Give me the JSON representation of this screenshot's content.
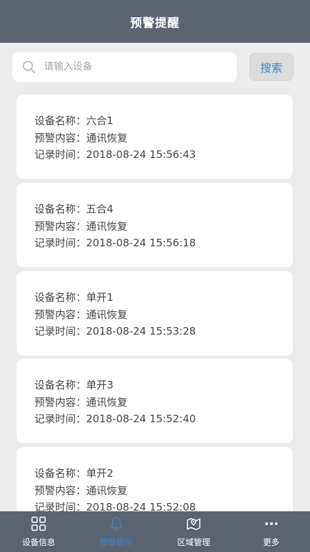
{
  "header": {
    "title": "预警提醒"
  },
  "search": {
    "placeholder": "请输入设备",
    "button_label": "搜索"
  },
  "records": [
    {
      "name": "设备名称：六合1",
      "content": "预警内容：通讯恢复",
      "time": "记录时间：2018-08-24 15:56:43"
    },
    {
      "name": "设备名称：五合4",
      "content": "预警内容：通讯恢复",
      "time": "记录时间：2018-08-24 15:56:18"
    },
    {
      "name": "设备名称：单开1",
      "content": "预警内容：通讯恢复",
      "time": "记录时间：2018-08-24 15:53:28"
    },
    {
      "name": "设备名称：单开3",
      "content": "预警内容：通讯恢复",
      "time": "记录时间：2018-08-24 15:52:40"
    },
    {
      "name": "设备名称：单开2",
      "content": "预警内容：通讯恢复",
      "time": "记录时间：2018-08-24 15:52:08"
    }
  ],
  "tabbar": {
    "items": [
      {
        "label": "设备信息",
        "icon": "grid-icon",
        "active": false
      },
      {
        "label": "预警提示",
        "icon": "bell-icon",
        "active": true
      },
      {
        "label": "区域管理",
        "icon": "map-icon",
        "active": false
      },
      {
        "label": "更多",
        "icon": "more-icon",
        "active": false
      }
    ]
  },
  "colors": {
    "header_bg": "#5b6370",
    "accent": "#3b86c8",
    "page_bg": "#ececec"
  }
}
